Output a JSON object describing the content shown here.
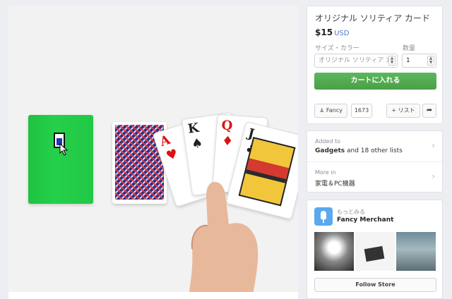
{
  "product": {
    "title": "オリジナル ソリティア カード",
    "price": "$15",
    "currency": "USD",
    "size_color_label": "サイズ・カラー",
    "size_color_value": "オリジナル ソリティア カ",
    "quantity_label": "数量",
    "quantity_value": "1",
    "add_to_cart": "カートに入れる",
    "fancy_label": "Fancy",
    "fancy_count": "1673",
    "list_label": "+ リスト"
  },
  "collections": {
    "added_to_label": "Added to",
    "added_to_list": "Gadgets",
    "added_to_rest": " and 18 other lists",
    "more_in_label": "More in",
    "more_in_value": "家電＆PC機器"
  },
  "merchant": {
    "small_label": "もっとみる",
    "name": "Fancy Merchant",
    "follow_label": "Follow Store"
  },
  "cards": {
    "c1_rank": "A",
    "c2_rank": "K",
    "c3_rank": "Q",
    "c4_rank": "J"
  },
  "colors": {
    "cart_green": "#4caf50",
    "accent_blue": "#4a7bc9",
    "box_green": "#22c846",
    "merchant_icon_blue": "#5aa9ee"
  },
  "icons": [
    "fancy-icon",
    "share-icon",
    "chevron-right-icon",
    "select-arrows-icon",
    "merchant-icon"
  ]
}
